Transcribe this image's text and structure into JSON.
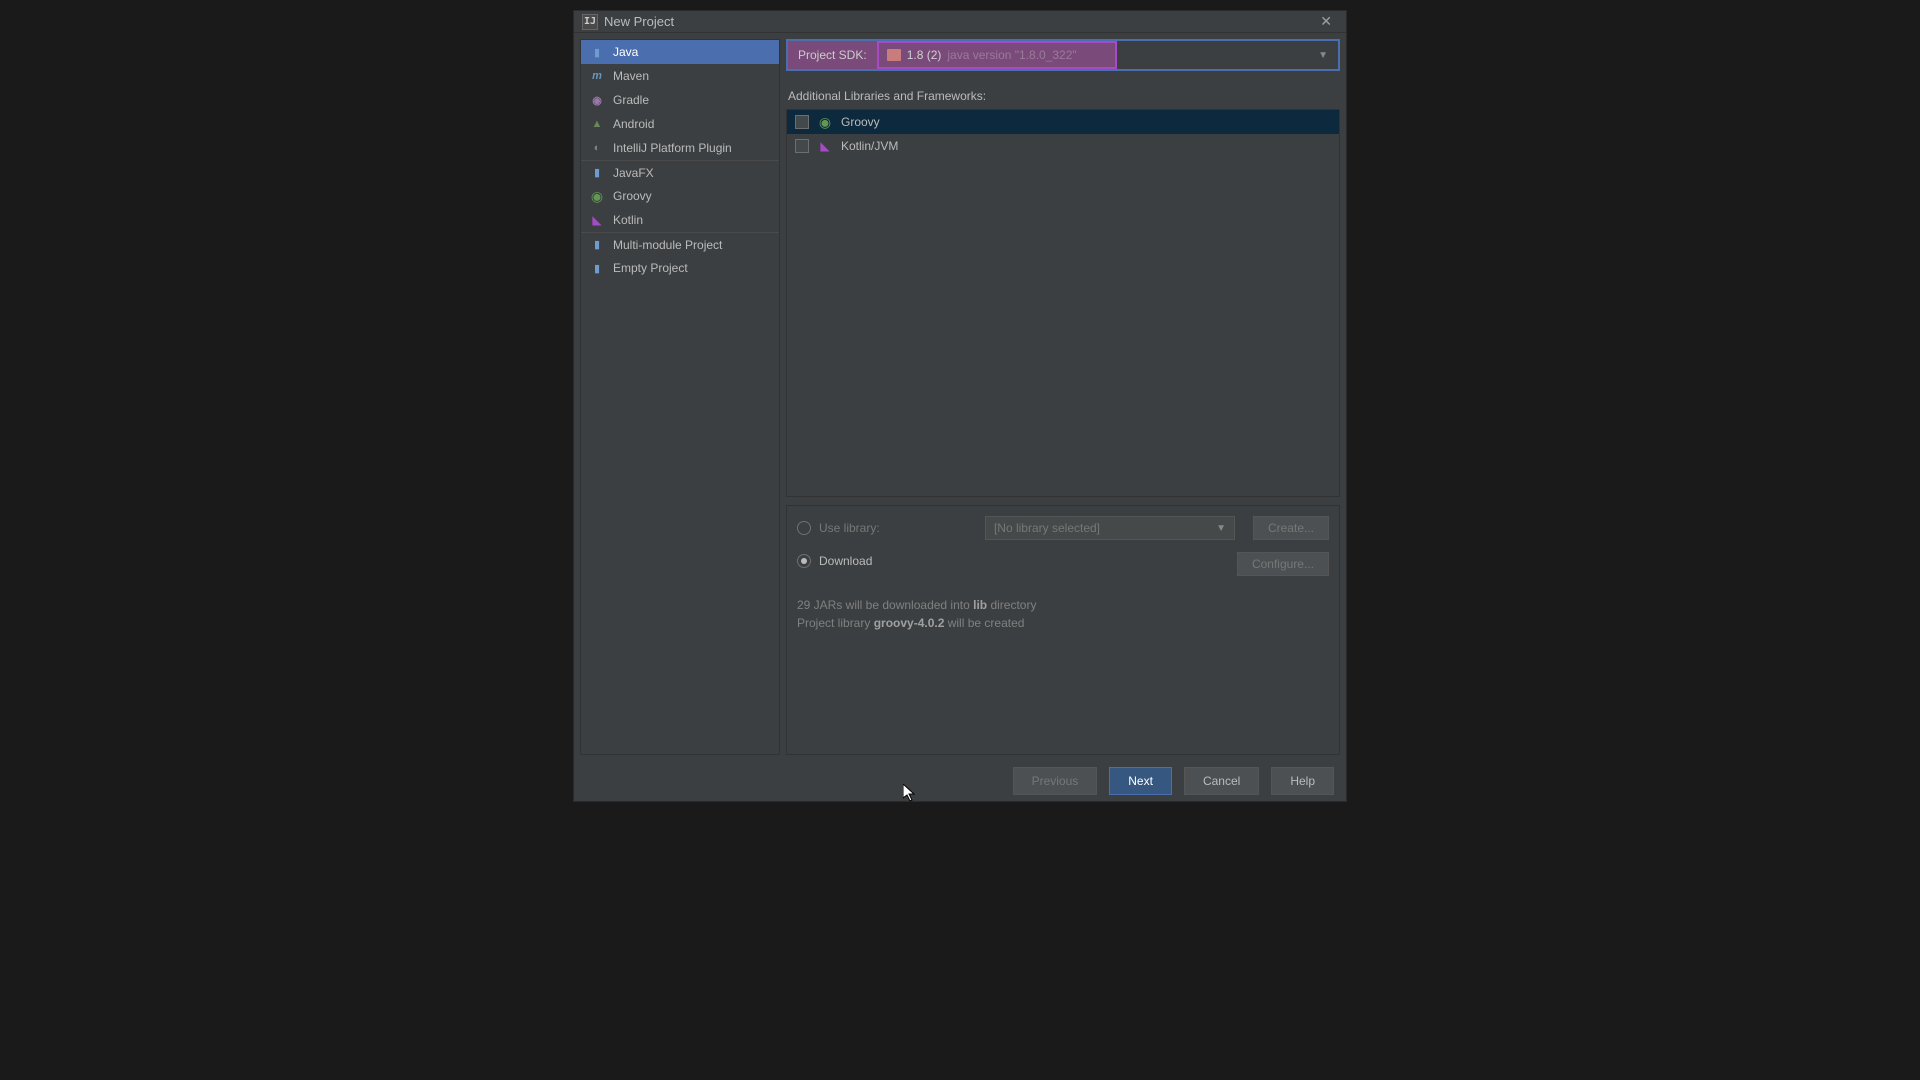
{
  "window": {
    "title": "New Project"
  },
  "sidebar": {
    "items": [
      {
        "label": "Java",
        "iconName": "folder-icon"
      },
      {
        "label": "Maven",
        "iconName": "maven-icon"
      },
      {
        "label": "Gradle",
        "iconName": "gradle-icon"
      },
      {
        "label": "Android",
        "iconName": "android-icon"
      },
      {
        "label": "IntelliJ Platform Plugin",
        "iconName": "plugin-icon"
      },
      {
        "label": "JavaFX",
        "iconName": "javafx-icon"
      },
      {
        "label": "Groovy",
        "iconName": "groovy-icon"
      },
      {
        "label": "Kotlin",
        "iconName": "kotlin-icon"
      },
      {
        "label": "Multi-module Project",
        "iconName": "folder-icon"
      },
      {
        "label": "Empty Project",
        "iconName": "folder-icon"
      }
    ]
  },
  "sdk": {
    "label": "Project SDK:",
    "version": "1.8 (2)",
    "detail": "java version \"1.8.0_322\""
  },
  "frameworks": {
    "label": "Additional Libraries and Frameworks:",
    "items": [
      {
        "label": "Groovy"
      },
      {
        "label": "Kotlin/JVM"
      }
    ]
  },
  "library": {
    "useLabel": "Use library:",
    "dropdownText": "[No library selected]",
    "createLabel": "Create...",
    "downloadLabel": "Download",
    "info1": "29 JARs will be downloaded into ",
    "info1b": "lib",
    "info1c": " directory",
    "info2": "Project library ",
    "info2b": "groovy-4.0.2",
    "info2c": " will be created",
    "configureLabel": "Configure..."
  },
  "footer": {
    "previous": "Previous",
    "next": "Next",
    "cancel": "Cancel",
    "help": "Help"
  }
}
